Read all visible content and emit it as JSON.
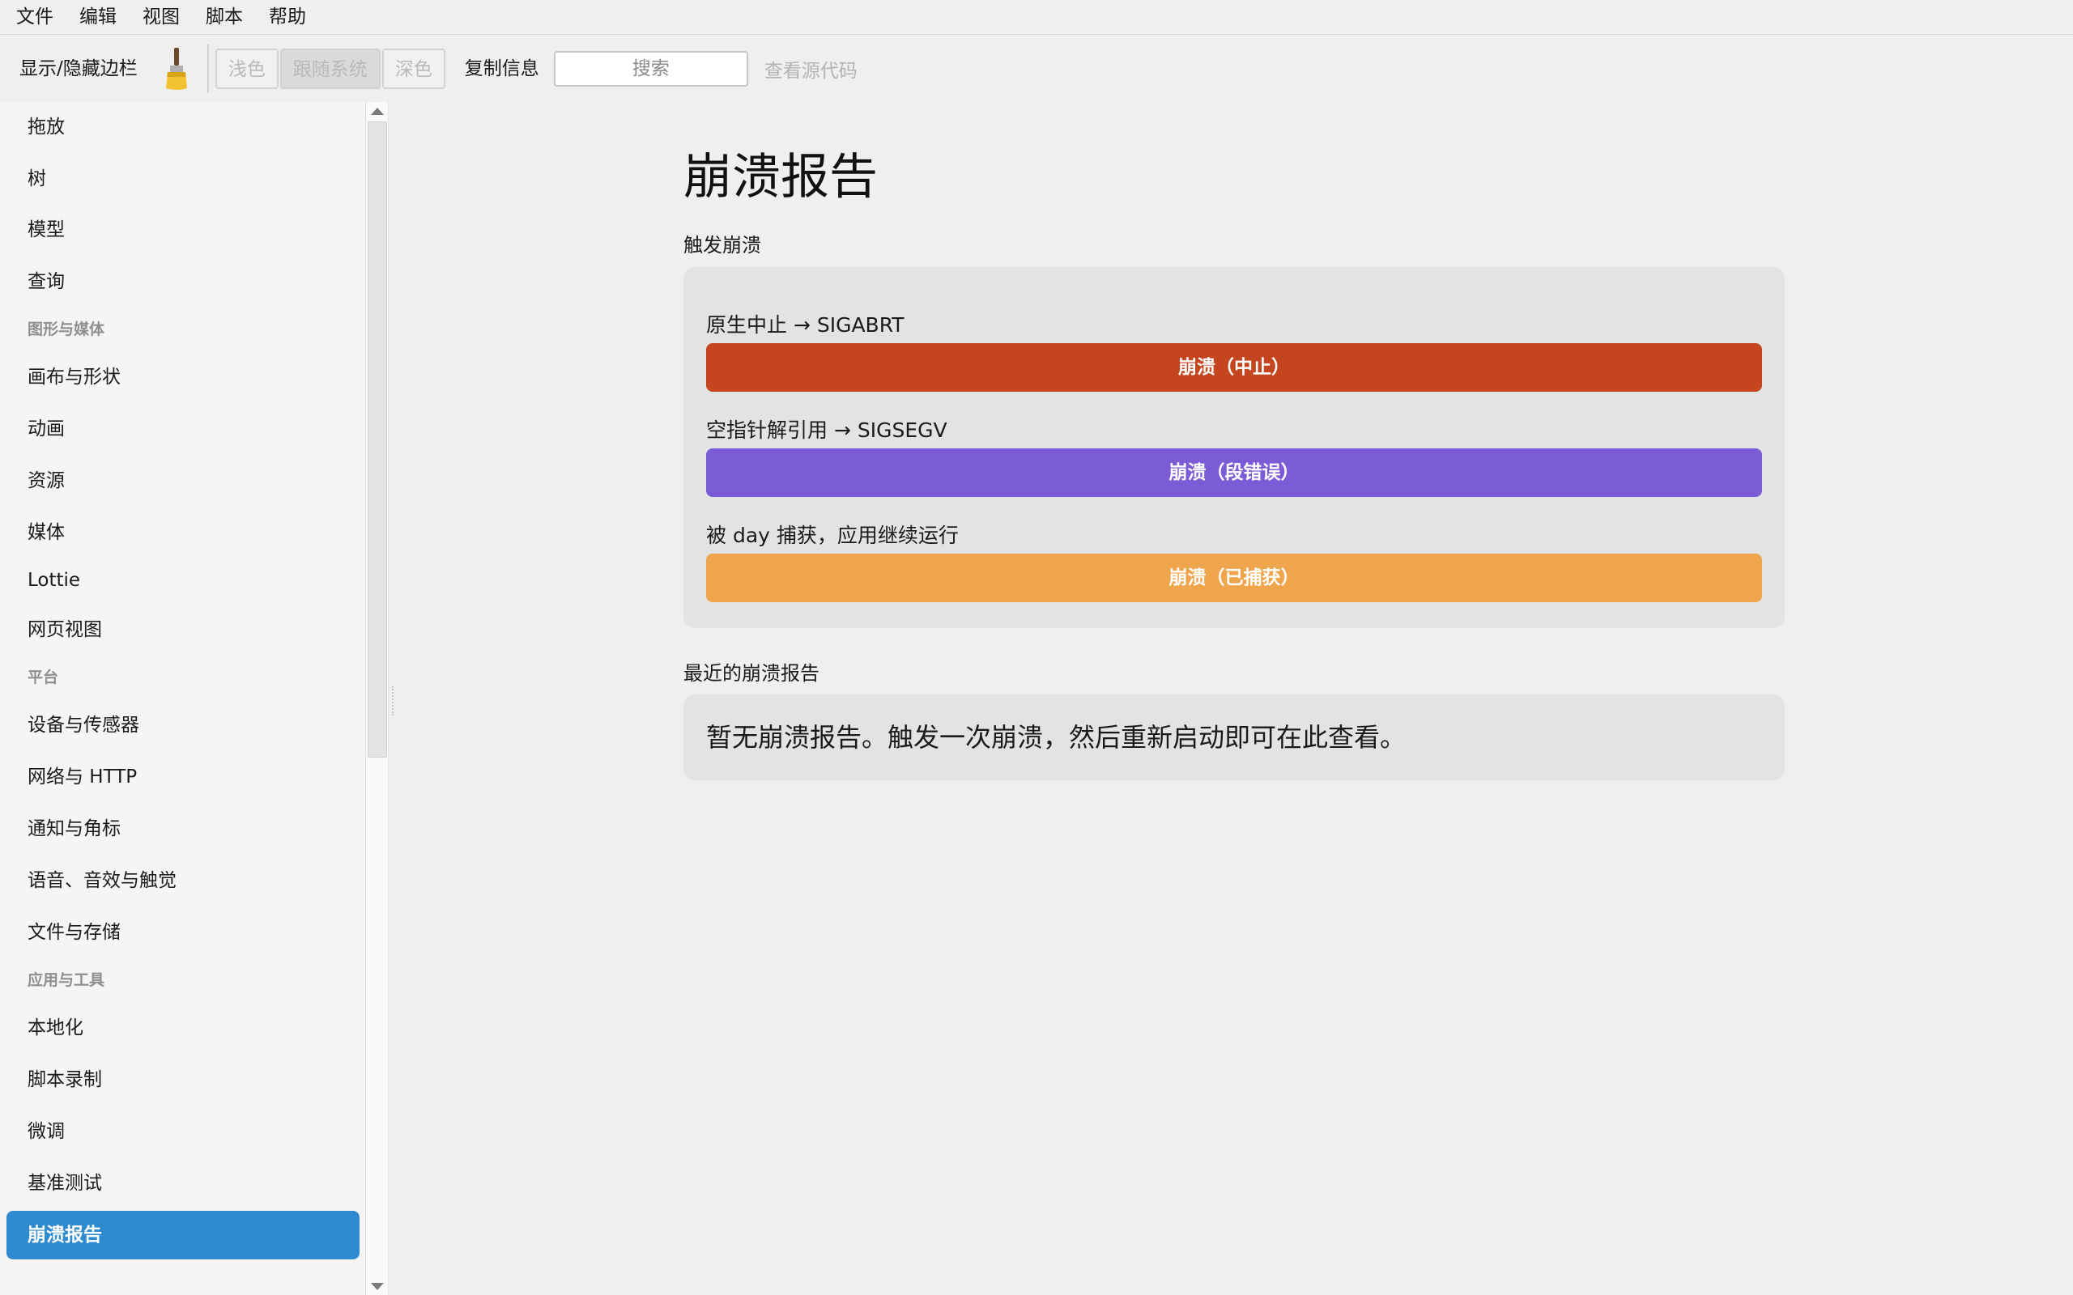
{
  "menubar": {
    "items": [
      "文件",
      "编辑",
      "视图",
      "脚本",
      "帮助"
    ]
  },
  "toolbar": {
    "toggle_sidebar": "显示/隐藏边栏",
    "brush_icon": "paintbrush-icon",
    "theme_light": "浅色",
    "theme_system": "跟随系统",
    "theme_dark": "深色",
    "theme_selected": "跟随系统",
    "copy_info": "复制信息",
    "search_placeholder": "搜索",
    "view_source": "查看源代码"
  },
  "sidebar": {
    "items": [
      {
        "type": "item",
        "label": "拖放"
      },
      {
        "type": "item",
        "label": "树"
      },
      {
        "type": "item",
        "label": "模型"
      },
      {
        "type": "item",
        "label": "查询"
      },
      {
        "type": "section",
        "label": "图形与媒体"
      },
      {
        "type": "item",
        "label": "画布与形状"
      },
      {
        "type": "item",
        "label": "动画"
      },
      {
        "type": "item",
        "label": "资源"
      },
      {
        "type": "item",
        "label": "媒体"
      },
      {
        "type": "item",
        "label": "Lottie"
      },
      {
        "type": "item",
        "label": "网页视图"
      },
      {
        "type": "section",
        "label": "平台"
      },
      {
        "type": "item",
        "label": "设备与传感器"
      },
      {
        "type": "item",
        "label": "网络与 HTTP"
      },
      {
        "type": "item",
        "label": "通知与角标"
      },
      {
        "type": "item",
        "label": "语音、音效与触觉"
      },
      {
        "type": "item",
        "label": "文件与存储"
      },
      {
        "type": "section",
        "label": "应用与工具"
      },
      {
        "type": "item",
        "label": "本地化"
      },
      {
        "type": "item",
        "label": "脚本录制"
      },
      {
        "type": "item",
        "label": "微调"
      },
      {
        "type": "item",
        "label": "基准测试"
      },
      {
        "type": "item",
        "label": "崩溃报告",
        "active": true
      }
    ]
  },
  "main": {
    "title": "崩溃报告",
    "trigger_section": "触发崩溃",
    "crashes": [
      {
        "description": "原生中止 → SIGABRT",
        "button": "崩溃（中止）",
        "color": "#c4451e"
      },
      {
        "description": "空指针解引用 → SIGSEGV",
        "button": "崩溃（段错误）",
        "color": "#7b5bd6"
      },
      {
        "description": "被 day 捕获，应用继续运行",
        "button": "崩溃（已捕获）",
        "color": "#efa54b"
      }
    ],
    "recent_section": "最近的崩溃报告",
    "empty_message": "暂无崩溃报告。触发一次崩溃，然后重新启动即可在此查看。"
  },
  "colors": {
    "accent": "#2f8bd0",
    "background": "#efefef",
    "card": "#e3e3e3"
  }
}
